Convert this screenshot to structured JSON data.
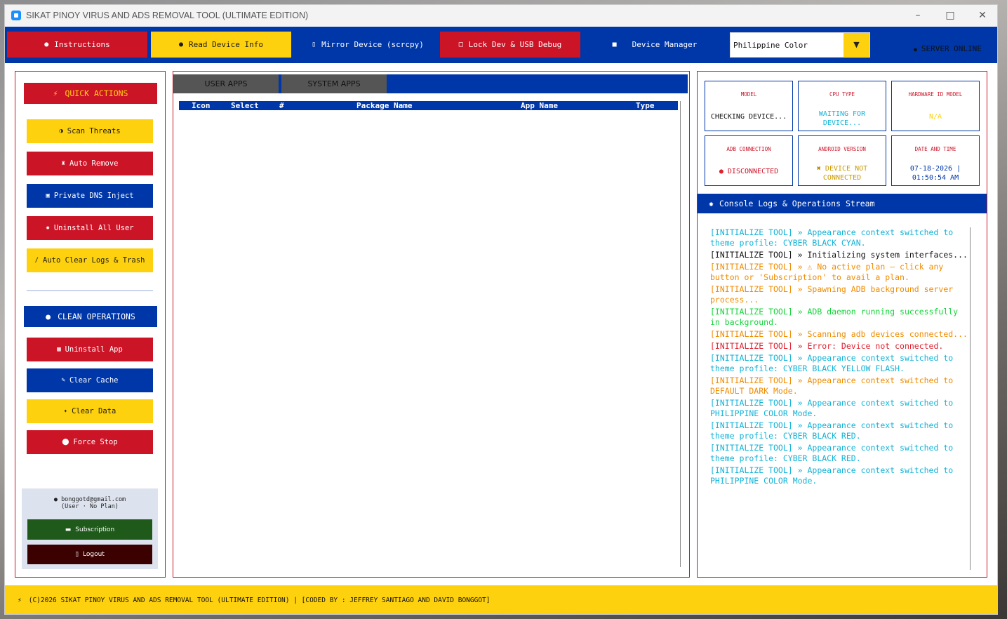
{
  "window": {
    "title": "SIKAT PINOY VIRUS AND ADS REMOVAL TOOL (ULTIMATE EDITION)"
  },
  "toolbar": {
    "instructions": "Instructions",
    "read_device": "Read Device Info",
    "mirror": "Mirror Device (scrcpy)",
    "lock": "Lock Dev & USB Debug",
    "device_manager": "Device Manager",
    "theme_select": "Philippine Color",
    "server_status": "SERVER ONLINE"
  },
  "sidebar": {
    "quick_actions": "QUICK ACTIONS",
    "scan": "Scan Threats",
    "auto_remove": "Auto Remove",
    "dns": "Private DNS Inject",
    "uninstall_all": "Uninstall All User",
    "clear_logs": "Auto Clear Logs & Trash",
    "clean_ops": "CLEAN OPERATIONS",
    "uninstall_app": "Uninstall App",
    "clear_cache": "Clear Cache",
    "clear_data": "Clear Data",
    "force_stop": "Force Stop",
    "user_email": "bonggotd@gmail.com",
    "user_plan": "(User · No Plan)",
    "subscription": "Subscription",
    "logout": "Logout"
  },
  "apps": {
    "tabs": [
      "USER APPS",
      "SYSTEM APPS"
    ],
    "columns": [
      "Icon",
      "Select",
      "#",
      "Package Name",
      "App Name",
      "Type"
    ]
  },
  "device": {
    "model_label": "MODEL",
    "model_value": "CHECKING DEVICE...",
    "cpu_label": "CPU TYPE",
    "cpu_value": "WAITING FOR DEVICE...",
    "hwid_label": "HARDWARE ID MODEL",
    "hwid_value": "N/A",
    "adb_label": "ADB CONNECTION",
    "adb_value": "DISCONNECTED",
    "android_label": "ANDROID VERSION",
    "android_value": "DEVICE NOT CONNECTED",
    "datetime_label": "DATE AND TIME",
    "datetime_value": "07-18-2026 | 01:50:54 AM"
  },
  "console": {
    "title": "Console Logs & Operations Stream",
    "logs": [
      "[INITIALIZE TOOL] » Appearance context switched to theme profile: CYBER BLACK CYAN.",
      "[INITIALIZE TOOL] » Initializing system interfaces...",
      "[INITIALIZE TOOL] » ⚠ No active plan — click any button or 'Subscription' to avail a plan.",
      "[INITIALIZE TOOL] » Spawning ADB background server process...",
      "[INITIALIZE TOOL] » ADB daemon running successfully in background.",
      "[INITIALIZE TOOL] » Scanning adb devices connected...",
      "[INITIALIZE TOOL] » Error: Device not connected.",
      "[INITIALIZE TOOL] » Appearance context switched to theme profile: CYBER BLACK YELLOW FLASH.",
      "[INITIALIZE TOOL] » Appearance context switched to DEFAULT DARK Mode.",
      "[INITIALIZE TOOL] » Appearance context switched to PHILIPPINE COLOR Mode.",
      "[INITIALIZE TOOL] » Appearance context switched to theme profile: CYBER BLACK RED.",
      "[INITIALIZE TOOL] » Appearance context switched to theme profile: CYBER BLACK RED.",
      "[INITIALIZE TOOL] » Appearance context switched to PHILIPPINE COLOR Mode."
    ]
  },
  "footer": {
    "text": "(C)2026 SIKAT PINOY VIRUS AND ADS REMOVAL TOOL (ULTIMATE EDITION) | [CODED BY : JEFFREY SANTIAGO AND DAVID BONGGOT]"
  },
  "colors": {
    "red": "#cc1427",
    "yellow": "#fed10e",
    "blue": "#0037a8"
  }
}
